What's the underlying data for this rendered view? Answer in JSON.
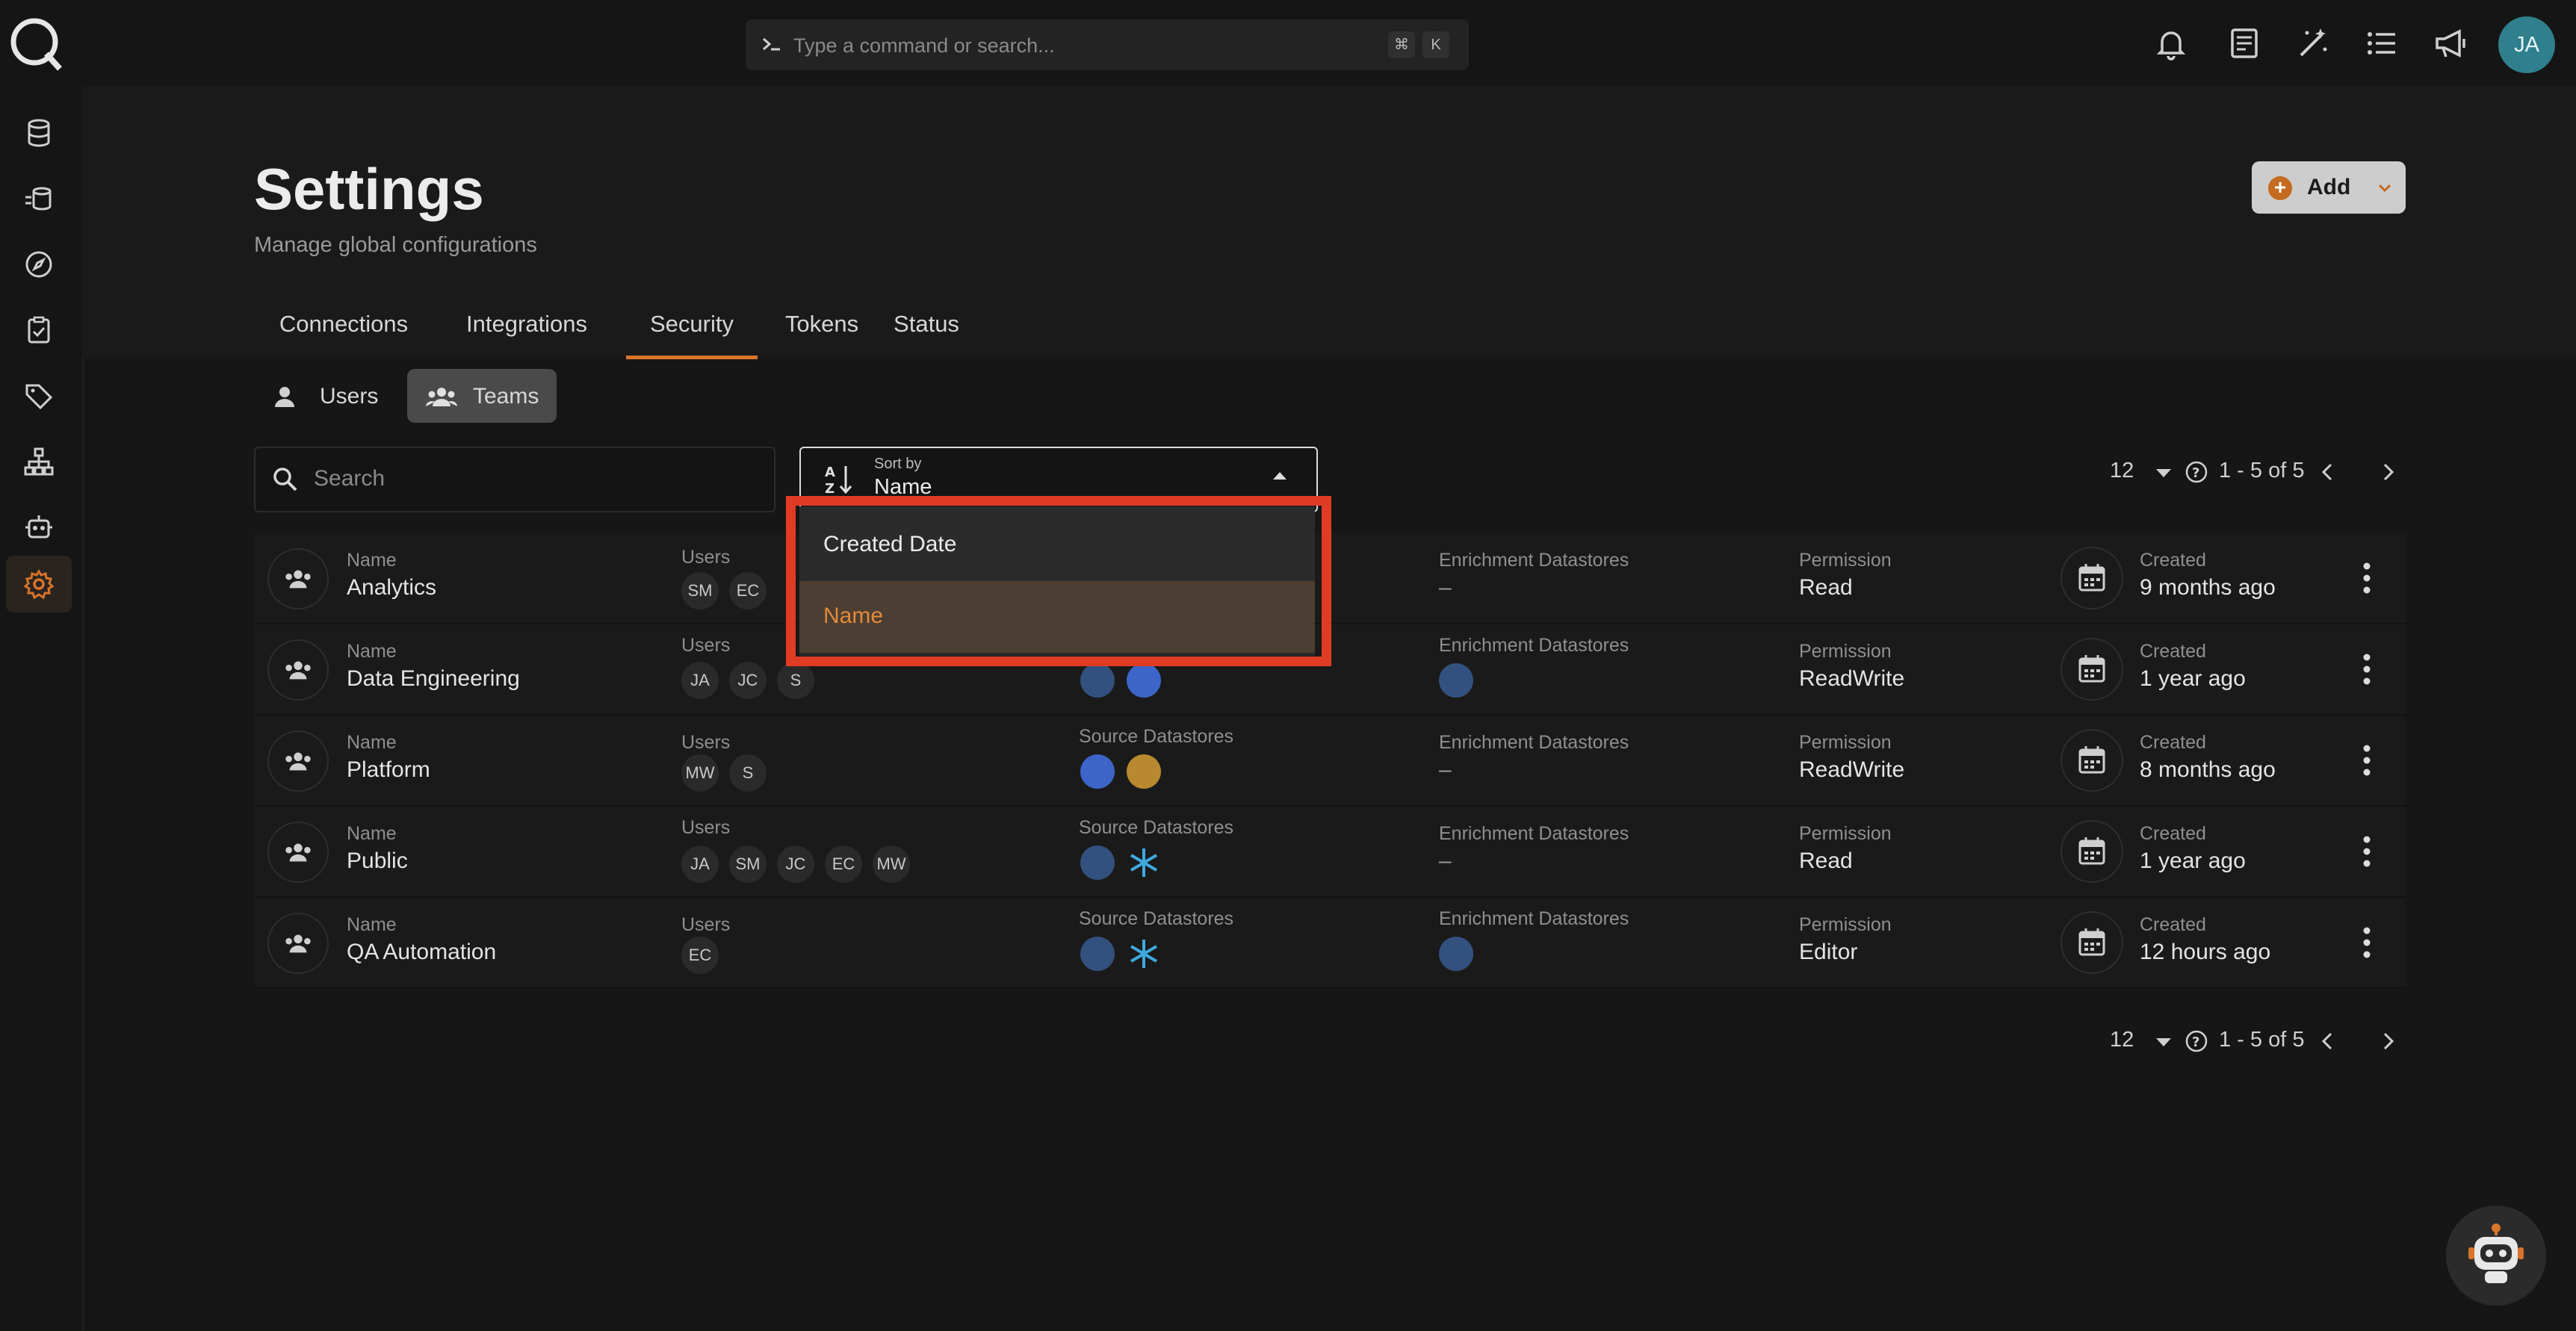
{
  "topbar": {
    "command_placeholder": "Type a command or search...",
    "shortcut_keys": [
      "⌘",
      "K"
    ],
    "avatar_initials": "JA",
    "icons": [
      "bell-icon",
      "document-icon",
      "magic-wand-icon",
      "list-icon",
      "megaphone-icon"
    ]
  },
  "sidebar": {
    "icons": [
      "database-icon",
      "datastore-stack-icon",
      "compass-icon",
      "checklist-icon",
      "tag-icon",
      "hierarchy-icon",
      "robot-icon",
      "settings-icon"
    ],
    "active": "settings-icon"
  },
  "header": {
    "title": "Settings",
    "subtitle": "Manage global configurations",
    "add_label": "Add"
  },
  "tabs": [
    "Connections",
    "Integrations",
    "Security",
    "Tokens",
    "Status"
  ],
  "active_tab": "Security",
  "segments": {
    "users": "Users",
    "teams": "Teams",
    "active": "Teams"
  },
  "search": {
    "placeholder": "Search"
  },
  "sort": {
    "caption": "Sort by",
    "value": "Name"
  },
  "sort_menu": {
    "options": [
      "Created Date",
      "Name"
    ],
    "selected": "Name"
  },
  "pagination": {
    "per_page": "12",
    "range": "1 - 5 of 5"
  },
  "columns": {
    "name": "Name",
    "users": "Users",
    "source": "Source Datastores",
    "enrichment": "Enrichment Datastores",
    "permission": "Permission",
    "created": "Created"
  },
  "rows": [
    {
      "name": "Analytics",
      "users": [
        "SM",
        "EC"
      ],
      "enrichment_empty": "–",
      "permission": "Read",
      "created": "9 months ago"
    },
    {
      "name": "Data Engineering",
      "users": [
        "JA",
        "JC",
        "S"
      ],
      "permission": "ReadWrite",
      "created": "1 year ago"
    },
    {
      "name": "Platform",
      "users": [
        "MW",
        "S"
      ],
      "enrichment_empty": "–",
      "permission": "ReadWrite",
      "created": "8 months ago"
    },
    {
      "name": "Public",
      "users": [
        "JA",
        "SM",
        "JC",
        "EC",
        "MW"
      ],
      "enrichment_empty": "–",
      "permission": "Read",
      "created": "1 year ago"
    },
    {
      "name": "QA Automation",
      "users": [
        "EC"
      ],
      "permission": "Editor",
      "created": "12 hours ago"
    }
  ],
  "colors": {
    "accent": "#d9742a",
    "highlight": "#e03b24",
    "selected_bg": "#4c3e32",
    "avatar": "#2f7f8c"
  }
}
